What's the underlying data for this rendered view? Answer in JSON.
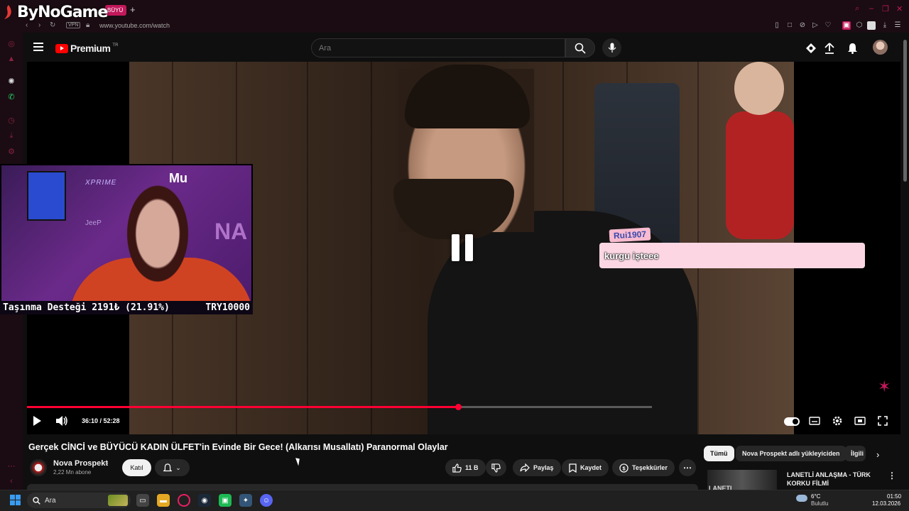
{
  "overlay": {
    "brand": "ByNoGame"
  },
  "browser": {
    "tab_label": "BÜYÜ",
    "new_tab": "+",
    "vpn": "VPN",
    "url": "www.youtube.com/watch"
  },
  "youtube": {
    "logo_text": "Premium",
    "region": "TR",
    "search_placeholder": "Ara"
  },
  "stream": {
    "cam_mu": "Mu",
    "cam_xprime": "XPRIME",
    "cam_jeep": "JeeP",
    "cam_na": "NA",
    "donation_label": "Taşınma Desteği 2191₺ (21.91%)",
    "donation_goal": "TRY10000",
    "donation_progress": 0.2191,
    "chat_user": "Rui1907",
    "chat_message": "kurgu işteee"
  },
  "player": {
    "time": "36:10 / 52:28",
    "progress": 0.6893,
    "buffered": 1.0
  },
  "video": {
    "title": "Gerçek CİNCİ ve BÜYÜCÜ KADIN ÜLFET'in Evinde Bir Gece! (Alkarısı Musallatı) Paranormal Olaylar",
    "channel": "Nova Prospekt",
    "subscribers": "2,22 Mn abone",
    "join_label": "Katıl",
    "likes": "11 B",
    "share_label": "Paylaş",
    "save_label": "Kaydet",
    "thanks_label": "Teşekkürler"
  },
  "sidebar": {
    "chips": [
      "Tümü",
      "Nova Prospekt adlı yükleyiciden",
      "İlgili"
    ],
    "rec_title": "LANETLİ ANLAŞMA - TÜRK KORKU FİLMİ",
    "rec_thumb_text": "LANETL"
  },
  "taskbar": {
    "search_label": "Ara",
    "temp": "6°C",
    "weather": "Bulutlu",
    "time": "01:50",
    "date": "12.03.2026"
  },
  "colors": {
    "accent": "#ff0033",
    "browser_accent": "#c2185b"
  }
}
